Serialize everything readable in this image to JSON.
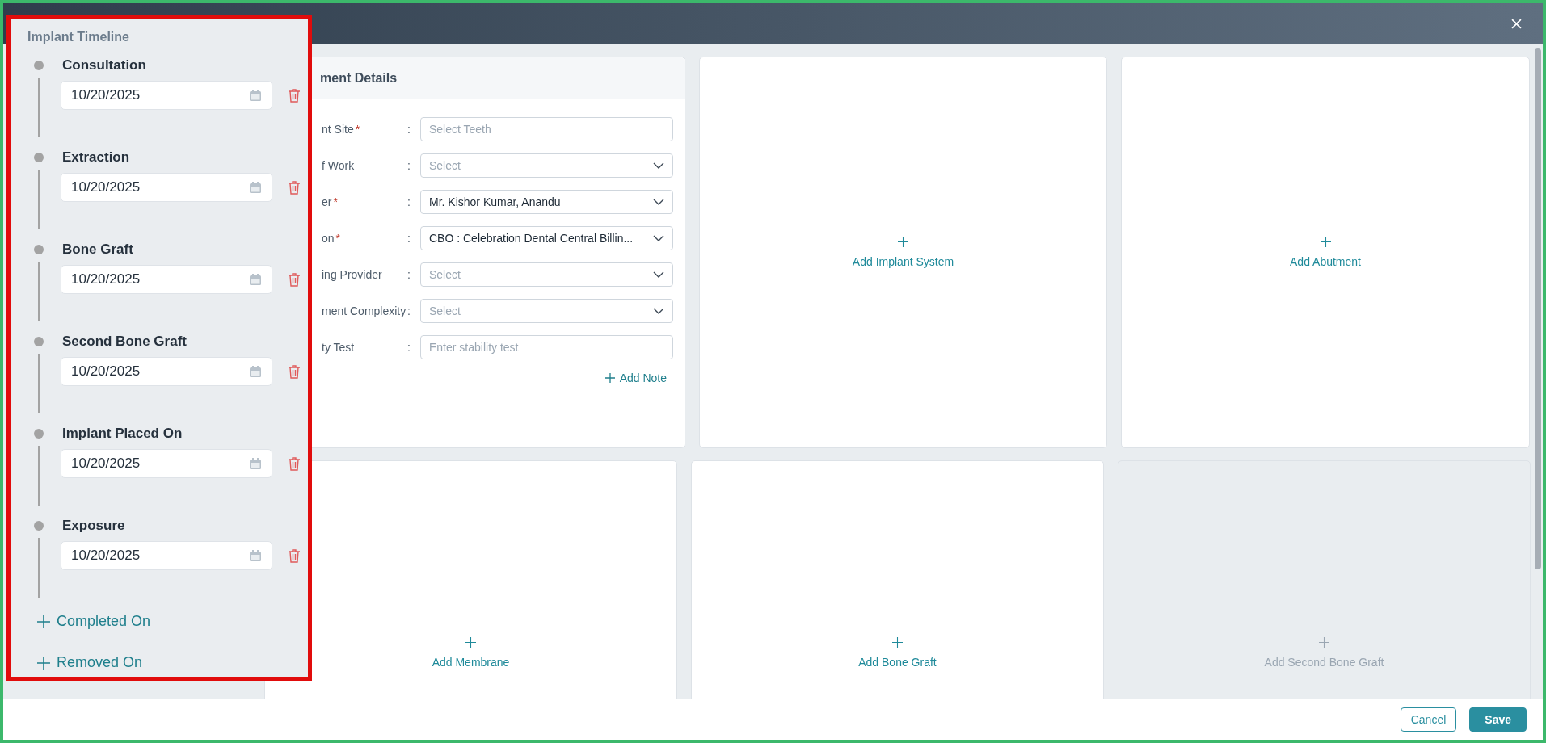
{
  "timeline": {
    "title": "Implant Timeline",
    "events": [
      {
        "label": "Consultation",
        "date": "10/20/2025"
      },
      {
        "label": "Extraction",
        "date": "10/20/2025"
      },
      {
        "label": "Bone Graft",
        "date": "10/20/2025"
      },
      {
        "label": "Second Bone Graft",
        "date": "10/20/2025"
      },
      {
        "label": "Implant Placed On",
        "date": "10/20/2025"
      },
      {
        "label": "Exposure",
        "date": "10/20/2025"
      }
    ],
    "add_links": [
      "Completed On",
      "Removed On"
    ]
  },
  "details": {
    "title": "ment Details",
    "fields": [
      {
        "label": "nt Site",
        "required_mark": "*",
        "colon": ":",
        "kind": "input",
        "placeholder": "Select Teeth"
      },
      {
        "label": "f Work",
        "colon": ":",
        "kind": "select",
        "placeholder": "Select"
      },
      {
        "label": "er",
        "required_mark": "*",
        "colon": ":",
        "kind": "select",
        "value": "Mr. Kishor Kumar, Anandu"
      },
      {
        "label": "on",
        "required_mark": "*",
        "colon": ":",
        "kind": "select",
        "value": "CBO : Celebration Dental Central Billin..."
      },
      {
        "label": "ing Provider",
        "colon": ":",
        "kind": "select",
        "placeholder": "Select"
      },
      {
        "label": "ment Complexity",
        "colon": ":",
        "kind": "select",
        "placeholder": "Select"
      },
      {
        "label": "ty Test",
        "colon": ":",
        "kind": "input",
        "placeholder": "Enter stability test"
      }
    ],
    "add_note": "Add Note"
  },
  "cards": [
    {
      "label": "Add Implant System",
      "disabled": false
    },
    {
      "label": "Add Abutment",
      "disabled": false
    },
    {
      "label": "Add Membrane",
      "disabled": false
    },
    {
      "label": "Add Bone Graft",
      "disabled": false
    },
    {
      "label": "Add Second Bone Graft",
      "disabled": true
    }
  ],
  "footer": {
    "buttons": [
      {
        "label": "Cancel",
        "kind": "secondary"
      },
      {
        "label": "Save",
        "kind": "primary"
      }
    ]
  }
}
